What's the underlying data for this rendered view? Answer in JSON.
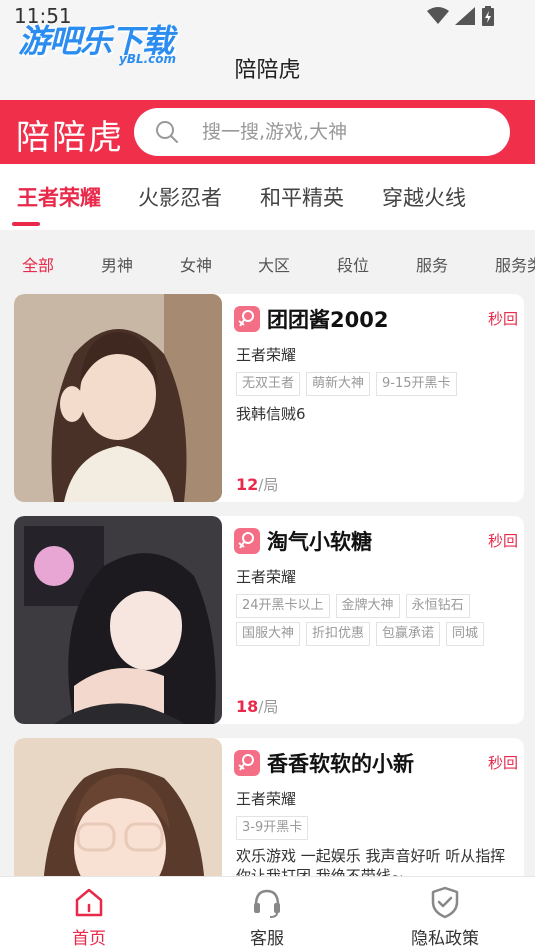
{
  "status_bar": {
    "time": "11:51"
  },
  "watermark": {
    "main": "游吧乐下载",
    "sub": "yBL.com"
  },
  "app_title": "陪陪虎",
  "brand": {
    "logo": "陪陪虎",
    "color": "#f0304b"
  },
  "search": {
    "placeholder": "搜一搜,游戏,大神"
  },
  "game_tabs": [
    {
      "label": "王者荣耀",
      "active": true
    },
    {
      "label": "火影忍者",
      "active": false
    },
    {
      "label": "和平精英",
      "active": false
    },
    {
      "label": "穿越火线",
      "active": false
    }
  ],
  "filters": [
    "全部",
    "男神",
    "女神",
    "大区",
    "段位",
    "服务",
    "服务类"
  ],
  "cards": [
    {
      "name": "团团酱2002",
      "fast": "秒回",
      "game": "王者荣耀",
      "tags": [
        "无双王者",
        "萌新大神",
        "9-15开黑卡"
      ],
      "desc": "我韩信贼6",
      "price": "12",
      "unit": "/局"
    },
    {
      "name": "淘气小软糖",
      "fast": "秒回",
      "game": "王者荣耀",
      "tags": [
        "24开黑卡以上",
        "金牌大神",
        "永恒钻石",
        "国服大神",
        "折扣优惠",
        "包赢承诺",
        "同城"
      ],
      "desc": "",
      "price": "18",
      "unit": "/局"
    },
    {
      "name": "香香软软的小新",
      "fast": "秒回",
      "game": "王者荣耀",
      "tags": [
        "3-9开黑卡"
      ],
      "desc": "欢乐游戏 一起娱乐 我声音好听 听从指挥 你让我打团 我绝不带线~",
      "price": "",
      "unit": ""
    }
  ],
  "bottom_nav": [
    {
      "label": "首页",
      "icon": "home-icon",
      "active": true
    },
    {
      "label": "客服",
      "icon": "headset-icon",
      "active": false
    },
    {
      "label": "隐私政策",
      "icon": "shield-check-icon",
      "active": false
    }
  ],
  "colors": {
    "accent": "#e8294a",
    "female_badge": "#f46f86"
  }
}
